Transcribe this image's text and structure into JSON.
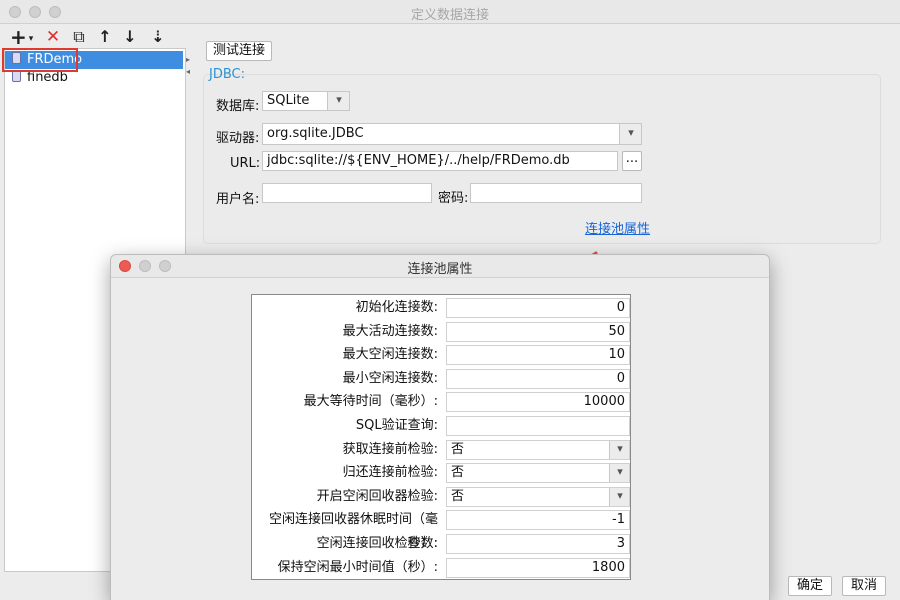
{
  "window": {
    "title": "定义数据连接"
  },
  "toolbar": {
    "add": "+",
    "add_caret": "▾",
    "delete": "✕",
    "copy": "⧉",
    "move_up": "↑",
    "move_down": "↓",
    "sort": "⇣"
  },
  "connections": [
    {
      "name": "FRDemo",
      "selected": true
    },
    {
      "name": "finedb",
      "selected": false
    }
  ],
  "right": {
    "test_button": "测试连接",
    "group_title": "JDBC:",
    "database_label": "数据库:",
    "database_value": "SQLite",
    "driver_label": "驱动器:",
    "driver_value": "org.sqlite.JDBC",
    "url_label": "URL:",
    "url_value": "jdbc:sqlite://${ENV_HOME}/../help/FRDemo.db",
    "browse_button": "...",
    "username_label": "用户名:",
    "username_value": "",
    "password_label": "密码:",
    "password_value": "",
    "pool_link": "连接池属性"
  },
  "buttons": {
    "ok": "确定",
    "cancel": "取消"
  },
  "dialog": {
    "title": "连接池属性",
    "rows": [
      {
        "label": "初始化连接数:",
        "value": "0",
        "type": "number"
      },
      {
        "label": "最大活动连接数:",
        "value": "50",
        "type": "number"
      },
      {
        "label": "最大空闲连接数:",
        "value": "10",
        "type": "number"
      },
      {
        "label": "最小空闲连接数:",
        "value": "0",
        "type": "number"
      },
      {
        "label": "最大等待时间（毫秒）:",
        "value": "10000",
        "type": "number"
      },
      {
        "label": "SQL验证查询:",
        "value": "",
        "type": "text"
      },
      {
        "label": "获取连接前检验:",
        "value": "否",
        "type": "select"
      },
      {
        "label": "归还连接前检验:",
        "value": "否",
        "type": "select"
      },
      {
        "label": "开启空闲回收器检验:",
        "value": "否",
        "type": "select"
      },
      {
        "label": "空闲连接回收器休眠时间（毫秒）:",
        "value": "-1",
        "type": "number"
      },
      {
        "label": "空闲连接回收检查数:",
        "value": "3",
        "type": "number"
      },
      {
        "label": "保持空闲最小时间值（秒）:",
        "value": "1800",
        "type": "number"
      }
    ]
  },
  "colors": {
    "selection": "#3f8de1",
    "highlight_border": "#e03a30",
    "link": "#1565d8",
    "arrow": "#e8503a"
  }
}
